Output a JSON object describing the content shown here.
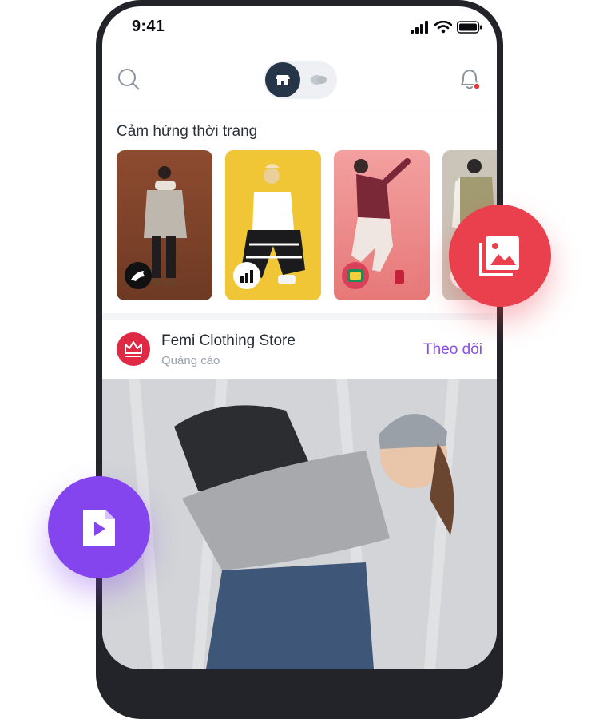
{
  "status_bar": {
    "time": "9:41"
  },
  "header": {
    "search_icon": "search-icon",
    "toggle_active": "store-icon",
    "toggle_inactive": "social-icon",
    "notification_icon": "bell-icon",
    "notification_dot_color": "#e53935"
  },
  "inspiration": {
    "title": "Cảm hứng thời trang",
    "stories": [
      {
        "brand_icon": "puma-logo",
        "bg": "#8a4a32"
      },
      {
        "brand_icon": "adidas-logo",
        "bg": "#f0c636"
      },
      {
        "brand_icon": "gucci-logo",
        "bg": "#f08c8c"
      },
      {
        "brand_icon": "brand-logo",
        "bg": "#cbc4b8"
      }
    ]
  },
  "ad_post": {
    "store_name": "Femi Clothing Store",
    "label": "Quảng cáo",
    "follow_label": "Theo dõi",
    "avatar_icon": "crown-icon"
  },
  "floating_buttons": [
    {
      "icon": "gallery-icon",
      "color": "#ea3f4d"
    },
    {
      "icon": "video-file-icon",
      "color": "#8545ee"
    }
  ],
  "colors": {
    "accent_purple": "#8a4fe8",
    "accent_red": "#e02a45",
    "dark": "#263648"
  }
}
